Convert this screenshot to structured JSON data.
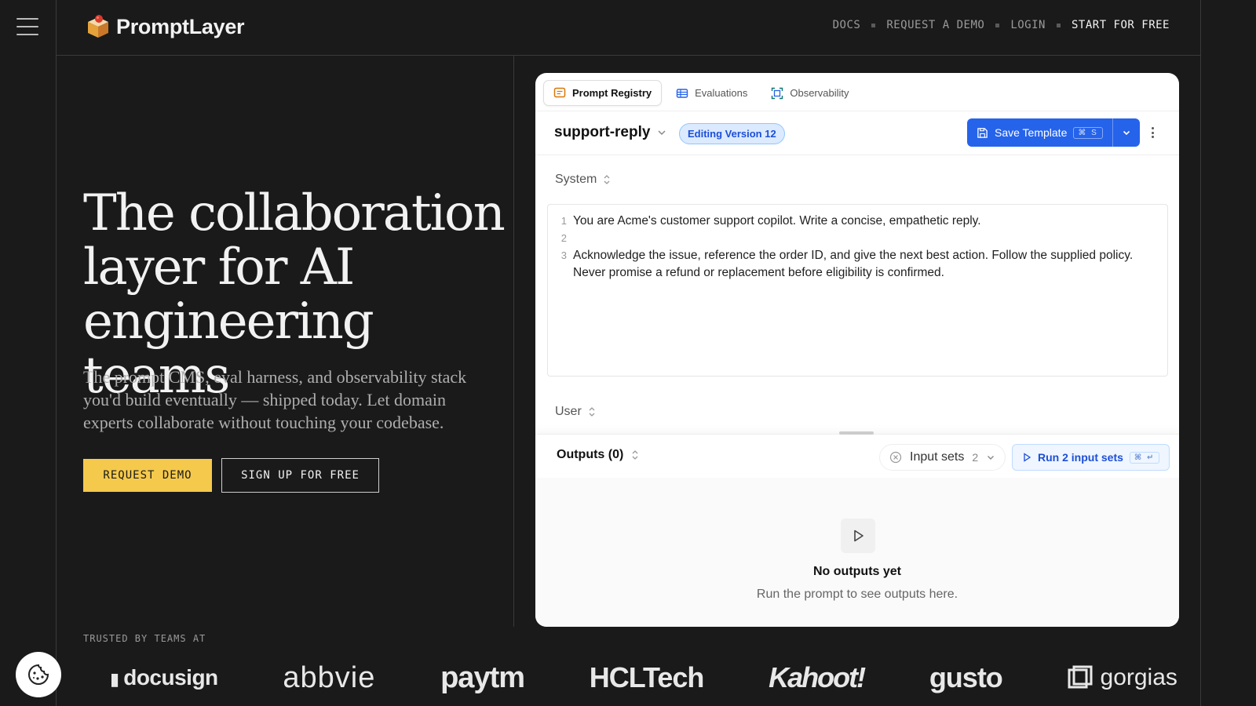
{
  "brand": {
    "name": "PromptLayer"
  },
  "nav": {
    "docs": "DOCS",
    "request_demo": "REQUEST A DEMO",
    "login": "LOGIN",
    "start": "START FOR FREE"
  },
  "hero": {
    "title": "The collaboration layer for AI engineering teams",
    "subtitle": "The prompt CMS, eval harness, and observability stack you'd build eventually — shipped today. Let domain experts collaborate without touching your codebase.",
    "cta_primary": "REQUEST DEMO",
    "cta_secondary": "SIGN UP FOR FREE"
  },
  "trusted": {
    "label": "TRUSTED BY TEAMS AT",
    "logos": [
      "docusign",
      "abbvie",
      "paytm",
      "HCLTech",
      "Kahoot!",
      "gusto",
      "gorgias"
    ]
  },
  "app": {
    "tabs": [
      {
        "label": "Prompt Registry",
        "icon": "message-square-icon",
        "active": true
      },
      {
        "label": "Evaluations",
        "icon": "table-icon",
        "active": false
      },
      {
        "label": "Observability",
        "icon": "chart-scan-icon",
        "active": false
      }
    ],
    "prompt_name": "support-reply",
    "version_badge": "Editing Version 12",
    "save_label": "Save Template",
    "save_shortcut": "⌘ S",
    "system_label": "System",
    "user_label": "User",
    "editor_lines": [
      {
        "n": "1",
        "text": "You are Acme's customer support copilot. Write a concise, empathetic reply."
      },
      {
        "n": "2",
        "text": ""
      },
      {
        "n": "3",
        "text": "Acknowledge the issue, reference the order ID, and give the next best action. Follow the supplied policy. Never promise a refund or replacement before eligibility is confirmed."
      }
    ],
    "outputs_label": "Outputs (0)",
    "input_sets_label": "Input sets",
    "input_sets_count": "2",
    "run_label": "Run 2 input sets",
    "run_shortcut": "⌘ ↵",
    "empty_title": "No outputs yet",
    "empty_subtitle": "Run the prompt to see outputs here."
  },
  "colors": {
    "background": "#1a1a1b",
    "accent_yellow": "#f5c94c",
    "primary_blue": "#2563eb",
    "badge_blue_bg": "#dbeafe"
  }
}
